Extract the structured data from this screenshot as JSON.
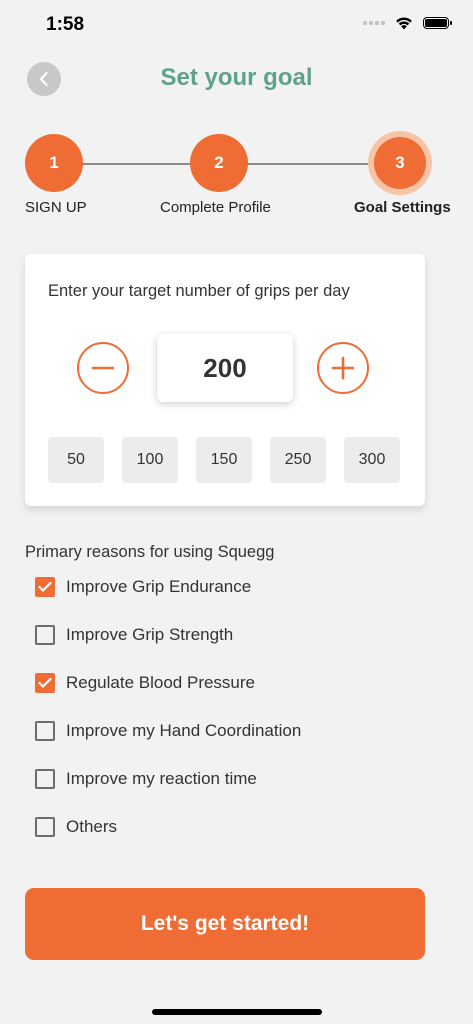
{
  "status": {
    "time": "1:58"
  },
  "header": {
    "title": "Set your goal",
    "back_icon": "chevron-left-icon"
  },
  "stepper": {
    "steps": [
      {
        "number": "1",
        "label": "SIGN UP"
      },
      {
        "number": "2",
        "label": "Complete Profile"
      },
      {
        "number": "3",
        "label": "Goal Settings",
        "active": true
      }
    ]
  },
  "target": {
    "prompt": "Enter your target number of grips per day",
    "value": "200",
    "presets": [
      "50",
      "100",
      "150",
      "250",
      "300"
    ]
  },
  "reasons": {
    "title": "Primary reasons for using Squegg",
    "items": [
      {
        "label": "Improve Grip Endurance",
        "checked": true
      },
      {
        "label": "Improve Grip Strength",
        "checked": false
      },
      {
        "label": "Regulate Blood Pressure",
        "checked": true
      },
      {
        "label": "Improve my Hand Coordination",
        "checked": false
      },
      {
        "label": "Improve my reaction time",
        "checked": false
      },
      {
        "label": "Others",
        "checked": false
      }
    ]
  },
  "cta": {
    "label": "Let's get started!"
  },
  "colors": {
    "accent": "#ef6c34",
    "title": "#5ea289",
    "background": "#f2f2f2"
  }
}
